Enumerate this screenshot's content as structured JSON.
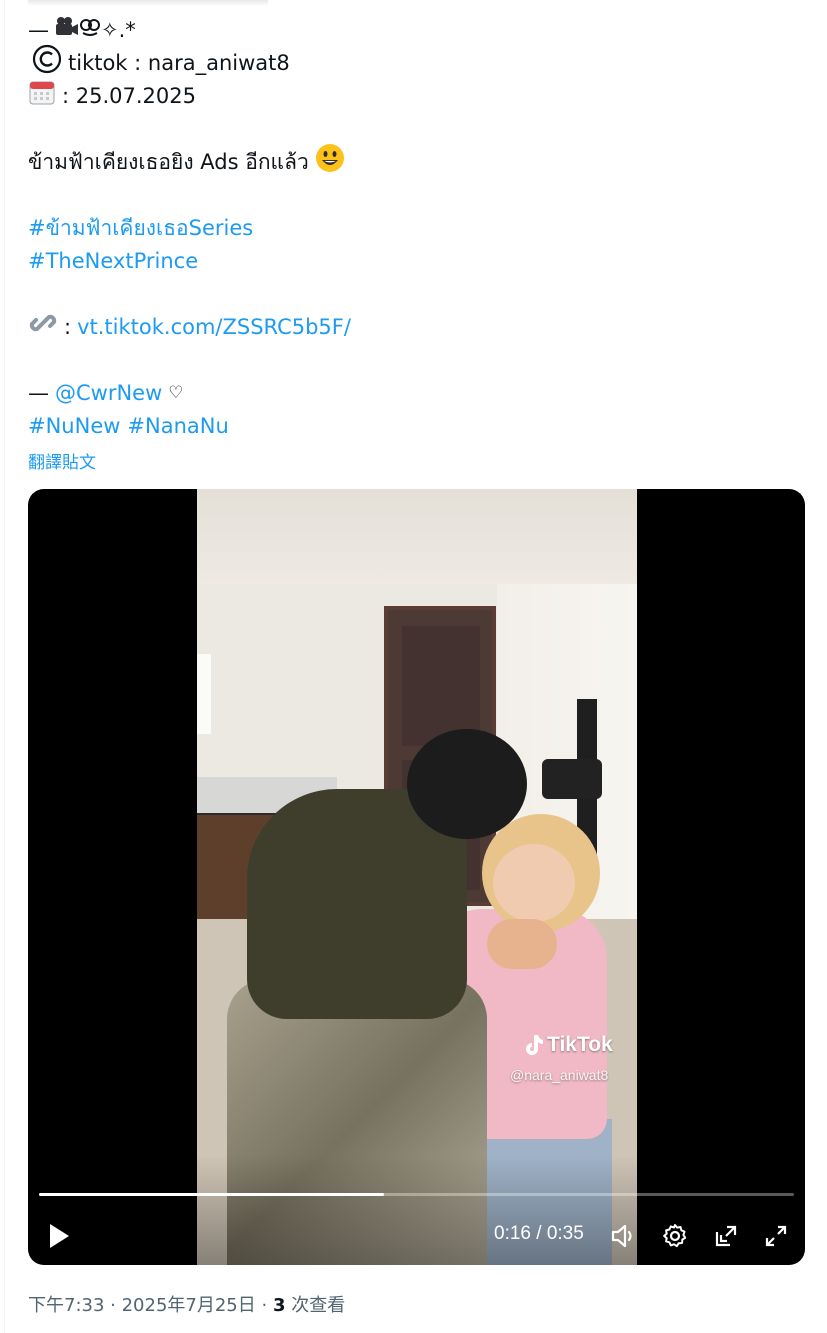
{
  "tweet": {
    "dash_prefix": "—",
    "header_symbols": "✧.*",
    "copyright_prefix": "tiktok : nara_aniwat8",
    "date_text": ": 25.07.2025",
    "caption": "ข้ามฟ้าเคียงเธอยิง Ads อีกแล้ว",
    "hashtag_series": "#ข้ามฟ้าเคียงเธอSeries",
    "hashtag_prince": "#TheNextPrince",
    "link_prefix": ":",
    "link_text": "vt.tiktok.com/ZSSRC5b5F/",
    "credit_dash": "—",
    "mention": "@CwrNew",
    "heart": "♡",
    "hashtag_nunew": "#NuNew",
    "hashtag_nananu": "#NanaNu",
    "translate_label": "翻譯貼文"
  },
  "video": {
    "watermark_brand": "TikTok",
    "watermark_handle": "@nara_aniwat8",
    "current_time": "0:16",
    "time_separator": "/",
    "duration": "0:35",
    "progress_fraction": 0.457,
    "icons": [
      "play-icon",
      "volume-icon",
      "settings-icon",
      "pip-icon",
      "fullscreen-icon"
    ]
  },
  "meta": {
    "timestamp": "下午7:33 · 2025年7月25日 ·",
    "views_count": "3",
    "views_label": "次查看"
  },
  "colors": {
    "link": "#1d9bf0",
    "text": "#0f1419",
    "secondary": "#536471"
  }
}
